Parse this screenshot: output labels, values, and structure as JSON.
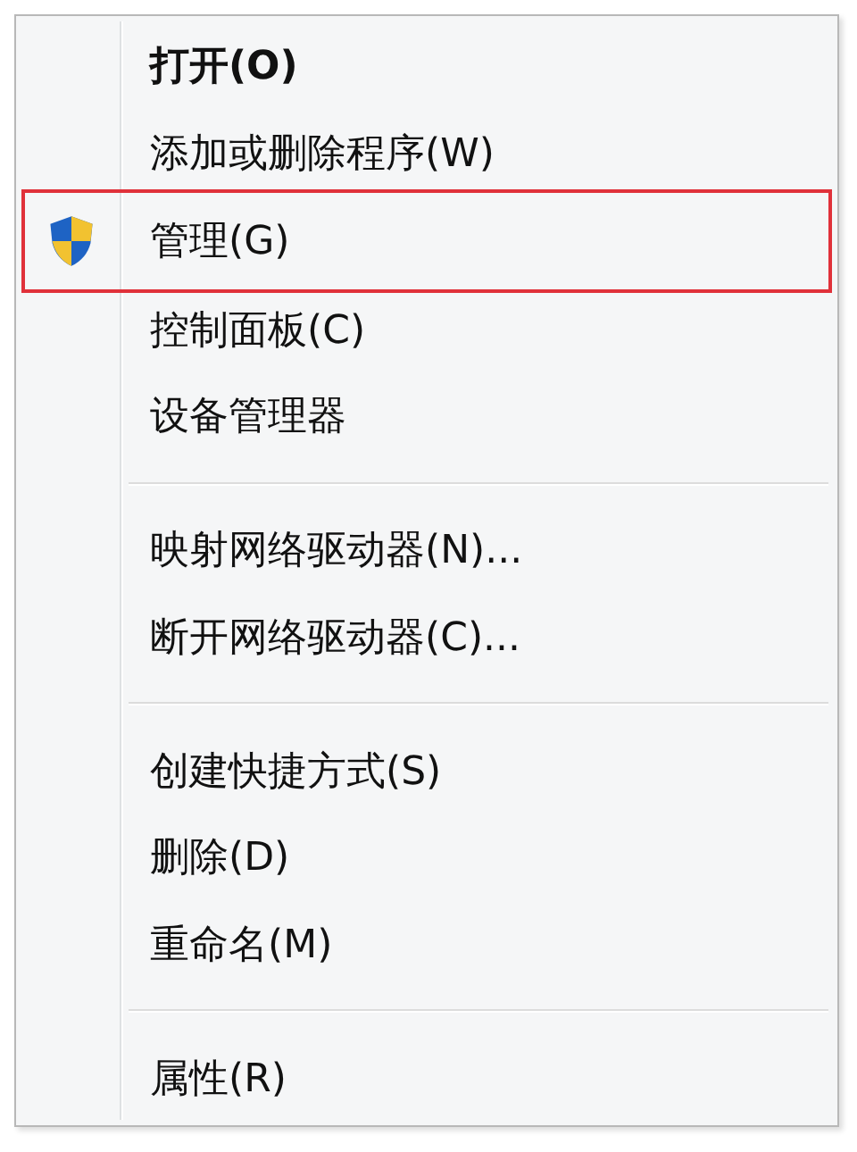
{
  "menu": {
    "items": [
      {
        "kind": "item",
        "label": "打开(O)",
        "default": true,
        "highlighted": false
      },
      {
        "kind": "item",
        "label": "添加或删除程序(W)",
        "default": false,
        "highlighted": false
      },
      {
        "kind": "elevated",
        "label": "管理(G)",
        "default": false,
        "highlighted": true
      },
      {
        "kind": "item",
        "label": "控制面板(C)",
        "default": false,
        "highlighted": false
      },
      {
        "kind": "item",
        "label": "设备管理器",
        "default": false,
        "highlighted": false
      },
      {
        "kind": "separator"
      },
      {
        "kind": "item",
        "label": "映射网络驱动器(N)...",
        "default": false,
        "highlighted": false
      },
      {
        "kind": "item",
        "label": "断开网络驱动器(C)...",
        "default": false,
        "highlighted": false
      },
      {
        "kind": "separator"
      },
      {
        "kind": "item",
        "label": "创建快捷方式(S)",
        "default": false,
        "highlighted": false
      },
      {
        "kind": "item",
        "label": "删除(D)",
        "default": false,
        "highlighted": false
      },
      {
        "kind": "item",
        "label": "重命名(M)",
        "default": false,
        "highlighted": false
      },
      {
        "kind": "separator"
      },
      {
        "kind": "item",
        "label": "属性(R)",
        "default": false,
        "highlighted": false
      }
    ]
  }
}
